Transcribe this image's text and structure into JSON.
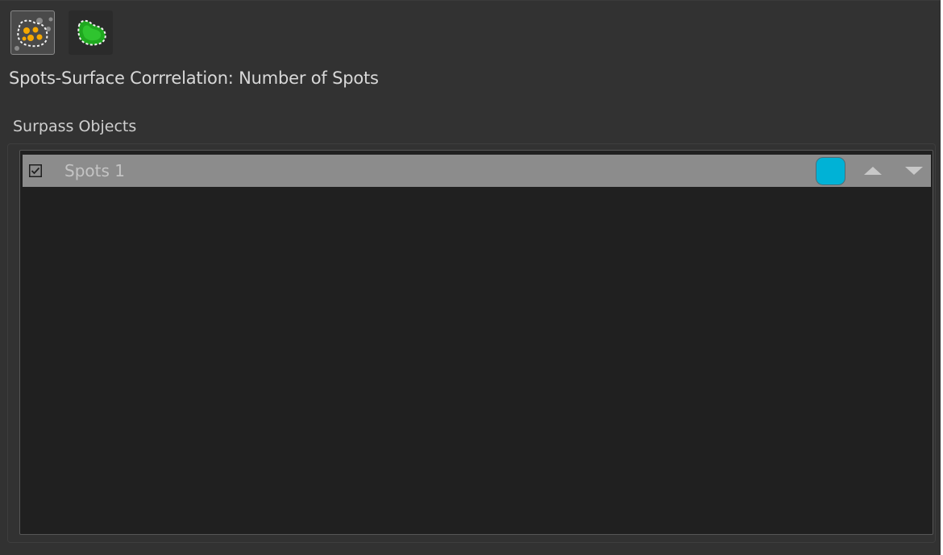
{
  "panel": {
    "title": "Spots-Surface Corrrelation: Number of Spots"
  },
  "toolbar": {
    "buttons": [
      {
        "name": "spots-mode",
        "icon": "spots-icon",
        "selected": true
      },
      {
        "name": "surface-mode",
        "icon": "surface-icon",
        "selected": false
      }
    ]
  },
  "surpass_objects": {
    "label": "Surpass Objects",
    "items": [
      {
        "label": "Spots 1",
        "checked": true,
        "color": "#00b2d6",
        "selected": true
      }
    ]
  },
  "colors": {
    "panel_bg": "#323232",
    "list_bg": "#202020",
    "selected_row": "#8c8c8c",
    "spot_orange": "#f5a800",
    "surface_green": "#1fa81f"
  }
}
